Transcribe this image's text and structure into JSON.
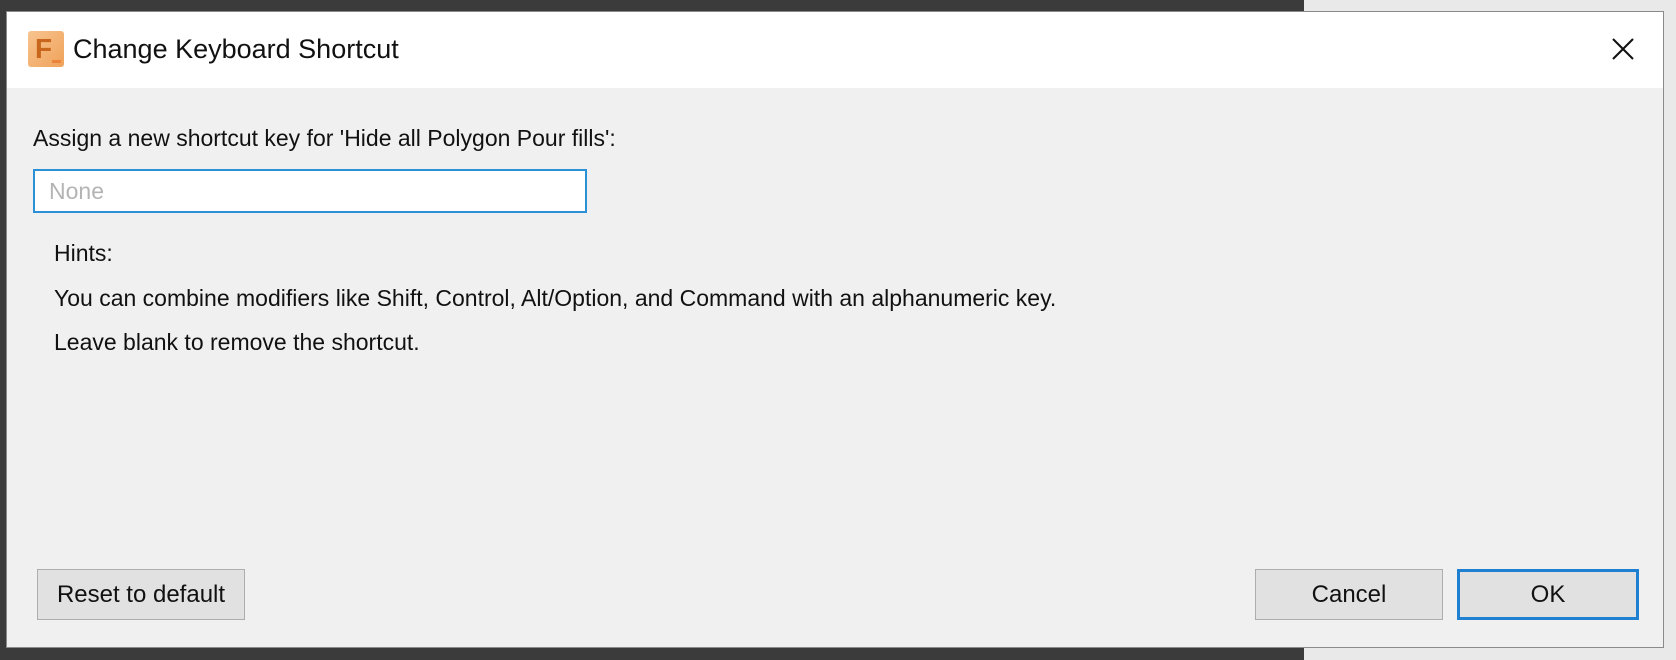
{
  "window": {
    "title": "Change Keyboard Shortcut",
    "icon": "fusion-app-icon",
    "icon_letter": "F",
    "close_icon": "close-icon"
  },
  "prompt": "Assign a new shortcut key for 'Hide all Polygon Pour fills':",
  "shortcut_input": {
    "value": "",
    "placeholder": "None"
  },
  "hints": {
    "heading": "Hints:",
    "lines": [
      "You can combine modifiers like Shift, Control, Alt/Option, and Command with an alphanumeric key.",
      "Leave blank to remove the shortcut."
    ]
  },
  "buttons": {
    "reset": "Reset to default",
    "cancel": "Cancel",
    "ok": "OK"
  },
  "colors": {
    "focus_accent": "#2d8fd6",
    "dialog_bg": "#f0f0f0",
    "titlebar_bg": "#ffffff",
    "app_icon": "#f0a25a"
  }
}
